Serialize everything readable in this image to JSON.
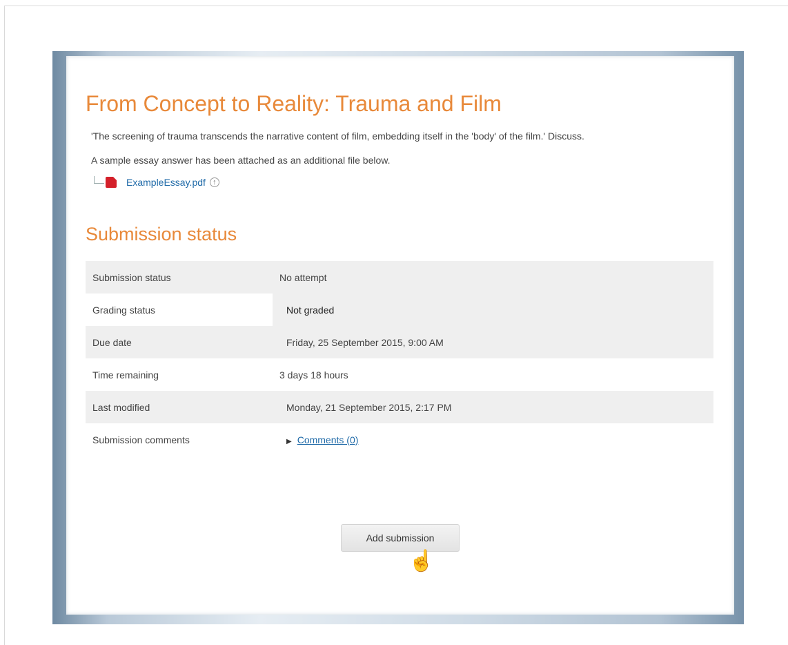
{
  "page": {
    "title": "From Concept to Reality: Trauma and Film",
    "description": "'The screening of trauma transcends the narrative content of film, embedding itself in the 'body' of the film.' Discuss.",
    "note": "A sample essay answer has been attached as an additional file below.",
    "attachment": {
      "filename": "ExampleEssay.pdf",
      "file_icon": "pdf-icon",
      "extra_icon": "portfolio-icon"
    }
  },
  "submission": {
    "heading": "Submission status",
    "rows": [
      {
        "label": "Submission status",
        "value": "No attempt"
      },
      {
        "label": "Grading status",
        "value": "Not graded"
      },
      {
        "label": "Due date",
        "value": "Friday, 25 September 2015, 9:00 AM"
      },
      {
        "label": "Time remaining",
        "value": "3 days 18 hours"
      },
      {
        "label": "Last modified",
        "value": "Monday, 21 September 2015, 2:17 PM"
      },
      {
        "label": "Submission comments",
        "value": "Comments (0)"
      }
    ],
    "button_label": "Add submission"
  },
  "colors": {
    "heading": "#e8893a",
    "link": "#1f6aa8",
    "row_shade": "#efefef",
    "pdf": "#d4202a"
  }
}
